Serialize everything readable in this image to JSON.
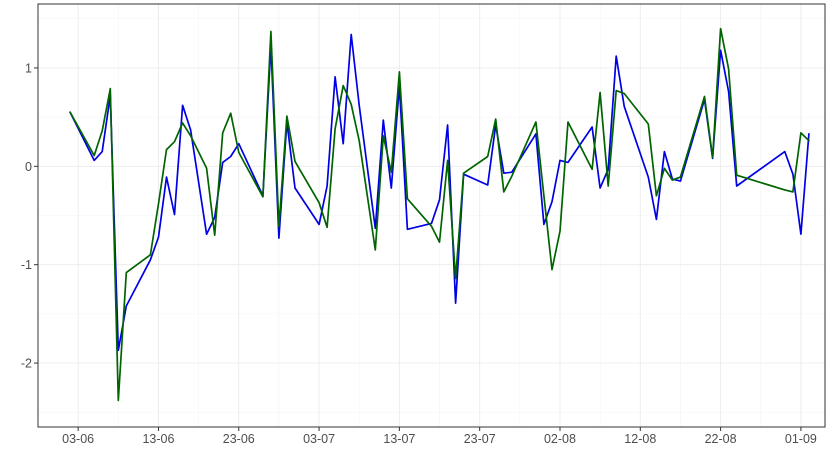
{
  "chart_data": {
    "type": "line",
    "title": "",
    "xlabel": "",
    "ylabel": "",
    "x_type": "date",
    "year": 2024,
    "xlim": [
      "2024-05-29",
      "2024-09-04"
    ],
    "ylim": [
      -2.65,
      1.65
    ],
    "x_ticks": [
      {
        "date": "2024-06-03",
        "label": "03-06"
      },
      {
        "date": "2024-06-13",
        "label": "13-06"
      },
      {
        "date": "2024-06-23",
        "label": "23-06"
      },
      {
        "date": "2024-07-03",
        "label": "03-07"
      },
      {
        "date": "2024-07-13",
        "label": "13-07"
      },
      {
        "date": "2024-07-23",
        "label": "23-07"
      },
      {
        "date": "2024-08-02",
        "label": "02-08"
      },
      {
        "date": "2024-08-12",
        "label": "12-08"
      },
      {
        "date": "2024-08-22",
        "label": "22-08"
      },
      {
        "date": "2024-09-01",
        "label": "01-09"
      }
    ],
    "y_ticks": [
      {
        "value": 1,
        "label": "1"
      },
      {
        "value": 0,
        "label": "0"
      },
      {
        "value": -1,
        "label": "-1"
      },
      {
        "value": -2,
        "label": "-2"
      }
    ],
    "grid": true,
    "legend": "none",
    "x": [
      "2024-06-02",
      "2024-06-05",
      "2024-06-06",
      "2024-06-07",
      "2024-06-08",
      "2024-06-09",
      "2024-06-12",
      "2024-06-13",
      "2024-06-14",
      "2024-06-15",
      "2024-06-16",
      "2024-06-17",
      "2024-06-19",
      "2024-06-20",
      "2024-06-21",
      "2024-06-22",
      "2024-06-23",
      "2024-06-26",
      "2024-06-27",
      "2024-06-28",
      "2024-06-29",
      "2024-06-30",
      "2024-07-03",
      "2024-07-04",
      "2024-07-05",
      "2024-07-06",
      "2024-07-07",
      "2024-07-08",
      "2024-07-10",
      "2024-07-11",
      "2024-07-12",
      "2024-07-13",
      "2024-07-14",
      "2024-07-17",
      "2024-07-18",
      "2024-07-19",
      "2024-07-20",
      "2024-07-21",
      "2024-07-24",
      "2024-07-25",
      "2024-07-26",
      "2024-07-27",
      "2024-07-30",
      "2024-07-31",
      "2024-08-01",
      "2024-08-02",
      "2024-08-03",
      "2024-08-06",
      "2024-08-07",
      "2024-08-08",
      "2024-08-09",
      "2024-08-10",
      "2024-08-13",
      "2024-08-14",
      "2024-08-15",
      "2024-08-16",
      "2024-08-17",
      "2024-08-20",
      "2024-08-21",
      "2024-08-22",
      "2024-08-23",
      "2024-08-24",
      "2024-08-30",
      "2024-08-31",
      "2024-09-01"
    ],
    "series": [
      {
        "color": "#0000e6",
        "values": [
          0.55,
          0.06,
          0.15,
          0.72,
          -1.87,
          -1.42,
          -0.95,
          -0.72,
          -0.11,
          -0.49,
          0.62,
          0.37,
          -0.69,
          -0.52,
          0.04,
          0.1,
          0.23,
          -0.3,
          1.23,
          -0.73,
          0.45,
          -0.22,
          -0.59,
          -0.2,
          0.91,
          0.23,
          1.34,
          0.62,
          -0.63,
          0.47,
          -0.22,
          0.82,
          -0.64,
          -0.58,
          -0.34,
          0.42,
          -1.39,
          -0.08,
          -0.19,
          0.42,
          -0.07,
          -0.06,
          0.33,
          -0.59,
          -0.36,
          0.06,
          0.04,
          0.4,
          -0.22,
          -0.03,
          1.12,
          0.61,
          -0.11,
          -0.54,
          0.15,
          -0.13,
          -0.15,
          0.68,
          0.08,
          1.18,
          0.76,
          -0.2,
          0.15,
          -0.08,
          -0.69
        ]
      },
      {
        "color": "#006400",
        "values": [
          0.55,
          0.11,
          0.36,
          0.79,
          -2.38,
          -1.08,
          -0.9,
          -0.38,
          0.17,
          0.25,
          0.44,
          0.31,
          -0.02,
          -0.7,
          0.34,
          0.54,
          0.14,
          -0.31,
          1.37,
          -0.61,
          0.51,
          0.05,
          -0.37,
          -0.62,
          0.38,
          0.82,
          0.63,
          0.26,
          -0.85,
          0.31,
          -0.06,
          0.96,
          -0.33,
          -0.61,
          -0.77,
          0.06,
          -1.14,
          -0.07,
          0.1,
          0.48,
          -0.26,
          -0.1,
          0.45,
          -0.3,
          -1.05,
          -0.66,
          0.45,
          -0.03,
          0.75,
          -0.2,
          0.77,
          0.74,
          0.43,
          -0.3,
          -0.02,
          -0.14,
          -0.11,
          0.71,
          0.09,
          1.4,
          0.99,
          -0.09,
          -0.24,
          -0.26,
          0.34
        ]
      }
    ],
    "final_point": {
      "date": "2024-09-02",
      "values": [
        0.33,
        0.26
      ]
    }
  }
}
